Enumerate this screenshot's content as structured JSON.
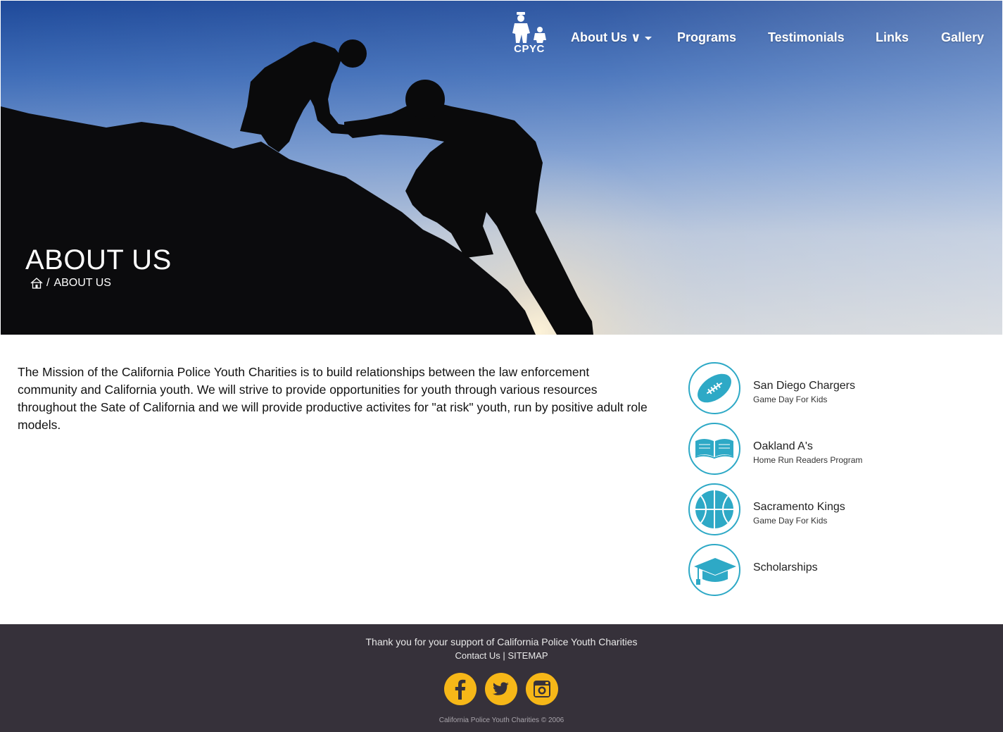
{
  "brand": {
    "logo_text": "CPYC",
    "accent_color": "#2ea9c6",
    "social_color": "#f6b718",
    "footer_bg": "#36313a"
  },
  "nav": {
    "items": [
      {
        "label": "About Us ∨",
        "has_dropdown": true
      },
      {
        "label": "Programs"
      },
      {
        "label": "Testimonials"
      },
      {
        "label": "Links"
      },
      {
        "label": "Gallery"
      }
    ]
  },
  "hero": {
    "title": "ABOUT US",
    "breadcrumb": {
      "home_icon": "home-icon",
      "separator": "/",
      "current": "ABOUT US"
    }
  },
  "main": {
    "mission_text": "The Mission of the California Police Youth Charities is to build relationships between the law enforcement community and California youth. We will strive to provide opportunities for youth through various resources throughout the Sate of California and we will provide productive activites for \"at risk\" youth, run by positive adult role models."
  },
  "programs": [
    {
      "icon": "football-icon",
      "title": "San Diego Chargers",
      "subtitle": "Game Day For Kids"
    },
    {
      "icon": "book-icon",
      "title": "Oakland A's",
      "subtitle": "Home Run Readers Program"
    },
    {
      "icon": "basketball-icon",
      "title": "Sacramento Kings",
      "subtitle": "Game Day For Kids"
    },
    {
      "icon": "graduation-cap-icon",
      "title": "Scholarships",
      "subtitle": ""
    }
  ],
  "footer": {
    "thanks": "Thank you for your support of California Police Youth Charities",
    "contact_label": "Contact Us",
    "link_separator": "|",
    "sitemap_label": "SITEMAP",
    "social": [
      "facebook-icon",
      "twitter-icon",
      "instagram-icon"
    ],
    "copyright": "California Police Youth Charities © 2006"
  }
}
